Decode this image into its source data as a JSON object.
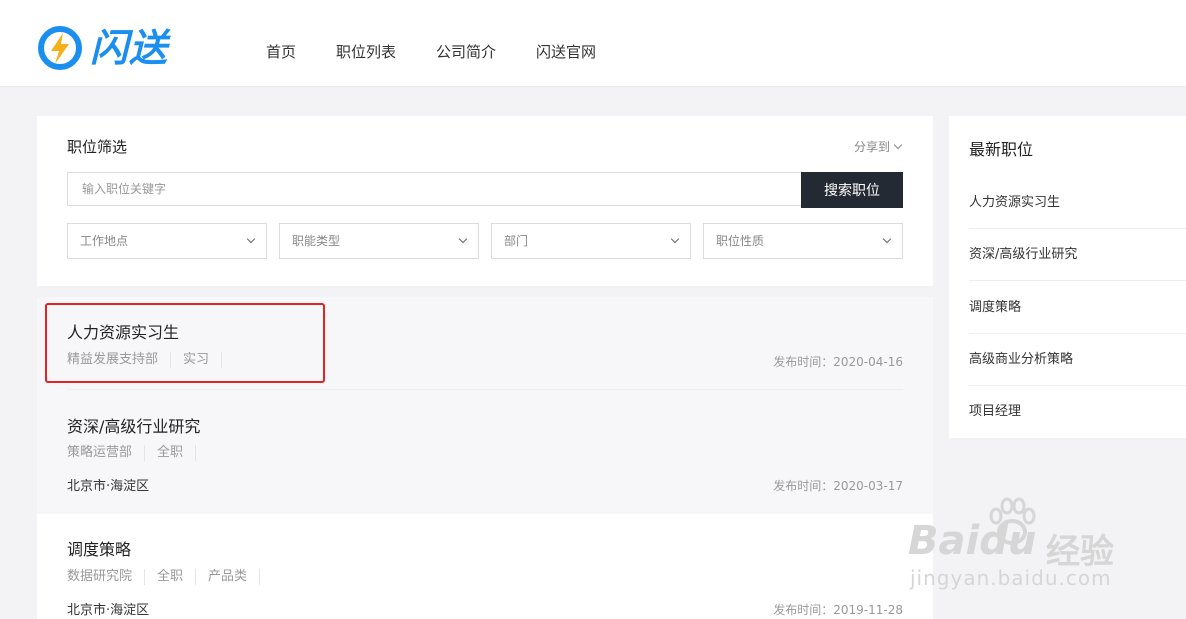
{
  "brand": {
    "name": "闪送",
    "color": "#1b8ff0"
  },
  "nav": {
    "items": [
      "首页",
      "职位列表",
      "公司简介",
      "闪送官网"
    ]
  },
  "filter": {
    "title": "职位筛选",
    "share_label": "分享到",
    "search_placeholder": "输入职位关键字",
    "search_button": "搜索职位",
    "selects": [
      "工作地点",
      "职能类型",
      "部门",
      "职位性质"
    ]
  },
  "jobs": [
    {
      "title": "人力资源实习生",
      "tags": [
        "精益发展支持部",
        "实习"
      ],
      "location": "",
      "date": "发布时间：2020-04-16"
    },
    {
      "title": "资深/高级行业研究",
      "tags": [
        "策略运营部",
        "全职"
      ],
      "location": "北京市·海淀区",
      "date": "发布时间：2020-03-17"
    },
    {
      "title": "调度策略",
      "tags": [
        "数据研究院",
        "全职",
        "产品类"
      ],
      "location": "北京市·海淀区",
      "date": "发布时间：2019-11-28"
    }
  ],
  "sidebar": {
    "title": "最新职位",
    "items": [
      "人力资源实习生",
      "资深/高级行业研究",
      "调度策略",
      "高级商业分析策略",
      "项目经理"
    ]
  },
  "watermark": {
    "main": "Baidu",
    "cn": "经验",
    "url": "jingyan.baidu.com"
  },
  "colors": {
    "accent": "#1b8ff0",
    "button": "#232a33",
    "highlight_box": "#e02424"
  }
}
